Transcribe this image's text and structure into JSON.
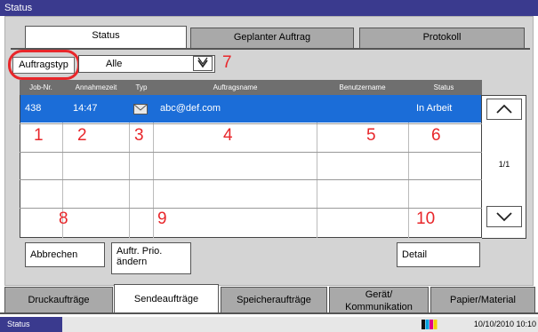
{
  "title": "Status",
  "tabs": [
    {
      "label": "Status",
      "active": true
    },
    {
      "label": "Geplanter Auftrag",
      "active": false
    },
    {
      "label": "Protokoll",
      "active": false
    }
  ],
  "filter": {
    "label": "Auftragstyp",
    "value": "Alle"
  },
  "table": {
    "headers": [
      "Job-Nr.",
      "Annahmezeit",
      "Typ",
      "Auftragsname",
      "Benutzername",
      "Status"
    ],
    "rows": [
      {
        "job_nr": "438",
        "time": "14:47",
        "type_icon": "mail-icon",
        "name": "abc@def.com",
        "user": "",
        "status": "In Arbeit"
      }
    ]
  },
  "page_indicator": "1/1",
  "callouts": [
    "1",
    "2",
    "3",
    "4",
    "5",
    "6",
    "7",
    "8",
    "9",
    "10"
  ],
  "buttons": {
    "cancel": "Abbrechen",
    "priority_line1": "Auftr. Prio.",
    "priority_line2": "ändern",
    "detail": "Detail"
  },
  "bottom_tabs": [
    {
      "label": "Druckaufträge",
      "active": false
    },
    {
      "label": "Sendeaufträge",
      "active": true
    },
    {
      "label": "Speicheraufträge",
      "active": false
    },
    {
      "label_line1": "Gerät/",
      "label_line2": "Kommunikation",
      "active": false
    },
    {
      "label": "Papier/Material",
      "active": false
    }
  ],
  "statusbar": {
    "label": "Status",
    "datetime": "10/10/2010 10:10"
  },
  "colors": {
    "accent": "#1b6dd8",
    "title_bar": "#3a3a8e",
    "callout": "#e8262a"
  }
}
